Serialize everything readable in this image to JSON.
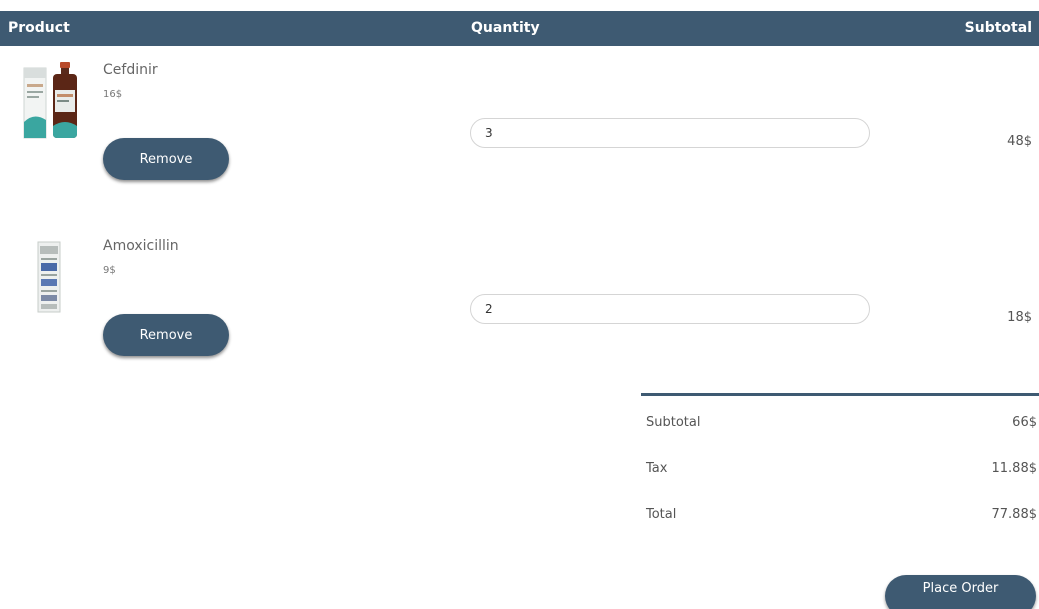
{
  "header": {
    "product_label": "Product",
    "quantity_label": "Quantity",
    "subtotal_label": "Subtotal"
  },
  "items": [
    {
      "name": "Cefdinir",
      "price": "16$",
      "quantity": "3",
      "subtotal": "48$",
      "remove_label": "Remove",
      "image_icon": "medicine-bottle-icon"
    },
    {
      "name": "Amoxicillin",
      "price": "9$",
      "quantity": "2",
      "subtotal": "18$",
      "remove_label": "Remove",
      "image_icon": "medicine-box-icon"
    }
  ],
  "summary": {
    "subtotal_label": "Subtotal",
    "subtotal_value": "66$",
    "tax_label": "Tax",
    "tax_value": "11.88$",
    "total_label": "Total",
    "total_value": "77.88$"
  },
  "place_order_label": "Place Order",
  "colors": {
    "accent": "#3e5a72",
    "header_text": "#ffffff",
    "muted_text": "#666666"
  }
}
